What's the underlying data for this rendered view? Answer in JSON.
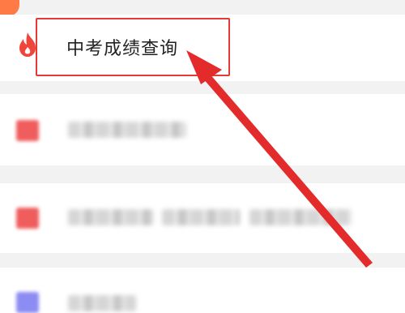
{
  "exam_query": {
    "label": "中考成绩查询",
    "icon": "flame-icon"
  },
  "colors": {
    "accent": "#ff7a45",
    "highlight": "#e53935",
    "flame": "#f0453a",
    "row_icon_red": "#f05d5d",
    "row_icon_blue": "#8c8cf2"
  },
  "annotation": {
    "box": "red-rectangle",
    "pointer": "red-arrow"
  }
}
